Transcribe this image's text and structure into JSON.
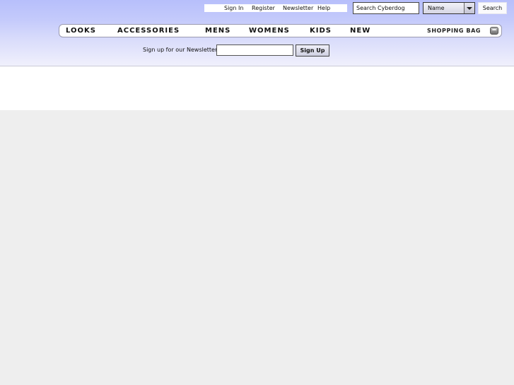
{
  "top_links": [
    "Sign In",
    "Register",
    "Newsletter",
    "Help"
  ],
  "search": {
    "value": "Search Cyberdog",
    "sort_selected": "Name",
    "button_label": "Search"
  },
  "nav": {
    "items": [
      "LOOKS",
      "ACCESSORIES",
      "MENS",
      "WOMENS",
      "KIDS",
      "NEW"
    ],
    "bag_label": "SHOPPING  BAG"
  },
  "newsletter": {
    "label": "Sign up for our Newsletter:",
    "value": "",
    "button_label": "Sign Up"
  }
}
